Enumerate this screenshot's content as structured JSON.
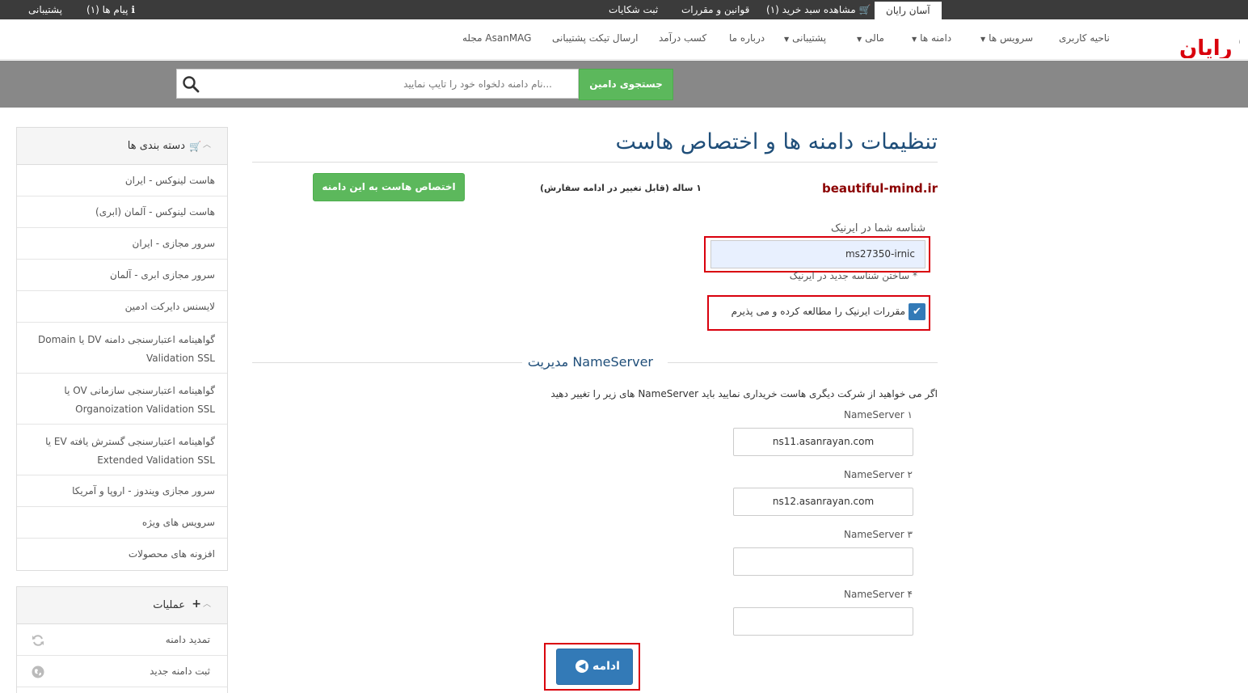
{
  "topbar": {
    "active_tab": "آسان رایان",
    "cart": "مشاهده سبد خرید (۱)",
    "rules": "قوانین و مقررات",
    "complaints": "ثبت شکایات",
    "messages": "پیام ها (۱)",
    "support": "پشتیبانی"
  },
  "nav": {
    "logo_text": "آسان رایان",
    "items": [
      "ناحیه کاربری",
      "سرویس ها",
      "دامنه ها",
      "مالی",
      "پشتیبانی",
      "درباره ما",
      "کسب درآمد",
      "ارسال تیکت پشتیبانی",
      "مجله AsanMAG"
    ]
  },
  "search": {
    "placeholder": "...نام دامنه دلخواه خود را تایپ نمایید",
    "button": "جستجوی دامین"
  },
  "sidebar": {
    "categories_title": "دسته بندی ها",
    "categories": [
      "هاست لینوکس - ایران",
      "هاست لینوکس - آلمان (ابری)",
      "سرور مجازی - ایران",
      "سرور مجازی ابری - آلمان",
      "لایسنس دایرکت ادمین",
      "گواهینامه اعتبارسنجی دامنه DV یا Domain Validation SSL",
      "گواهینامه اعتبارسنجی سازمانی OV یا Organoization Validation SSL",
      "گواهینامه اعتبارسنجی گسترش یافته EV یا Extended Validation SSL",
      "سرور مجازی ویندوز - اروپا و آمریکا",
      "سرویس های ویژه",
      "افزونه های محصولات"
    ],
    "actions_title": "عملیات",
    "actions": [
      "تمدید دامنه",
      "ثبت دامنه جدید"
    ]
  },
  "main": {
    "page_title": "تنظیمات دامنه ها و اختصاص هاست",
    "domain": "beautiful-mind.ir",
    "period": "۱ ساله (قابل تغییر در ادامه سفارش)",
    "assign_button": "اختصاص هاست به این دامنه",
    "irnic_label": "شناسه شما در ایرنیک",
    "irnic_value": "ms27350-irnic",
    "irnic_new": "* ساختن شناسه جدید در ایرنیک",
    "agree_label": "مقررات ایرنیک را مطالعه کرده و می پذیرم",
    "ns_legend": "مدیریت NameServer",
    "ns_help": "اگر می خواهید از شرکت دیگری هاست خریداری نمایید باید NameServer های زیر را تغییر دهید",
    "nameservers": [
      {
        "label": "NameServer ۱",
        "value": "ns11.asanrayan.com"
      },
      {
        "label": "NameServer ۲",
        "value": "ns12.asanrayan.com"
      },
      {
        "label": "NameServer ۳",
        "value": ""
      },
      {
        "label": "NameServer ۴",
        "value": ""
      }
    ],
    "continue_button": "ادامه"
  },
  "colors": {
    "accent_green": "#5cb85c",
    "accent_blue": "#337ab7",
    "highlight_red": "#d9000d",
    "domain_red": "#8b0000"
  }
}
